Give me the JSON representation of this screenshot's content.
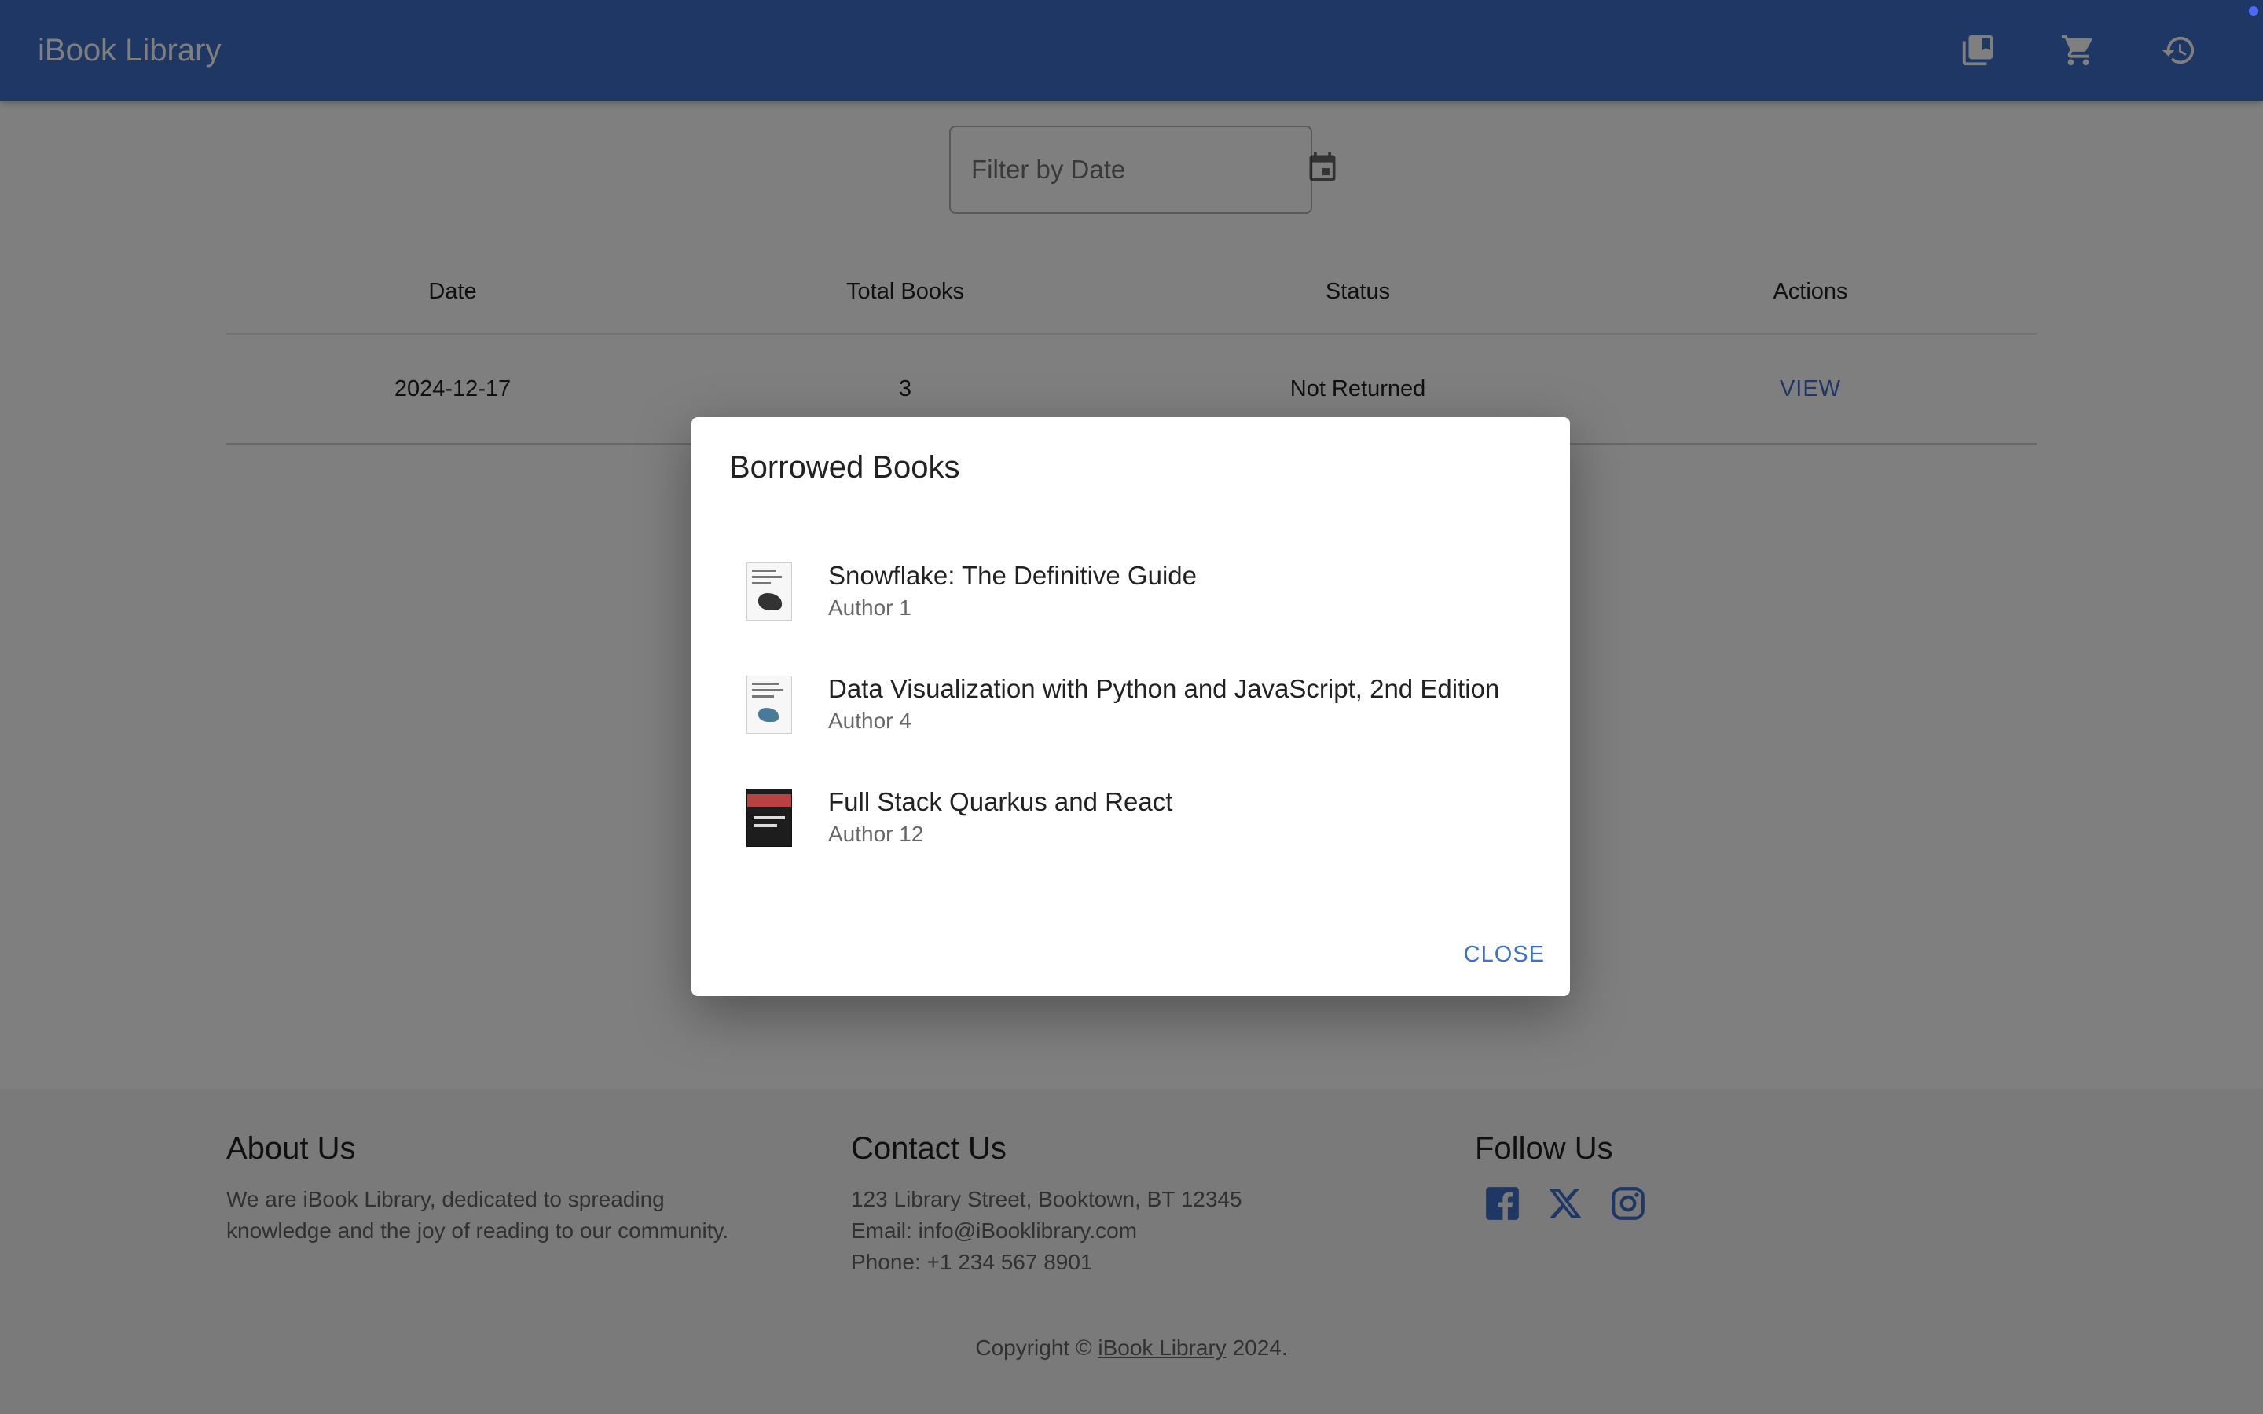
{
  "app": {
    "title": "iBook Library"
  },
  "appbar": {
    "icons": [
      "library-books-icon",
      "shopping-cart-icon",
      "history-icon"
    ]
  },
  "filter": {
    "placeholder": "Filter by Date"
  },
  "table": {
    "headers": [
      "Date",
      "Total Books",
      "Status",
      "Actions"
    ],
    "rows": [
      {
        "date": "2024-12-17",
        "total": "3",
        "status": "Not Returned",
        "action": "VIEW"
      }
    ]
  },
  "footer": {
    "about": {
      "title": "About Us",
      "text": [
        "We are iBook Library, dedicated to spreading",
        "knowledge and the joy of reading to our community."
      ]
    },
    "contact": {
      "title": "Contact Us",
      "address": "123 Library Street, Booktown, BT 12345",
      "email": "Email: info@iBooklibrary.com",
      "phone": "Phone: +1 234 567 8901"
    },
    "follow": {
      "title": "Follow Us"
    },
    "copyright": {
      "prefix": "Copyright ©",
      "link": "iBook Library",
      "suffix": "2024."
    }
  },
  "dialog": {
    "title": "Borrowed Books",
    "books": [
      {
        "title": "Snowflake: The Definitive Guide",
        "author": "Author 1"
      },
      {
        "title": "Data Visualization with Python and JavaScript, 2nd Edition",
        "author": "Author 4"
      },
      {
        "title": "Full Stack Quarkus and React",
        "author": "Author 12"
      }
    ],
    "close_label": "CLOSE"
  },
  "colors": {
    "primary": "#3f6fc8",
    "backdrop": "rgba(0,0,0,0.5)"
  }
}
